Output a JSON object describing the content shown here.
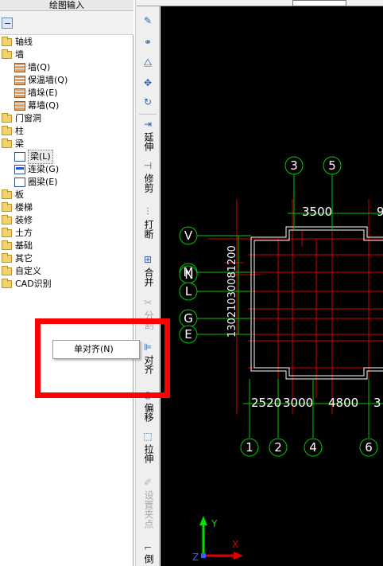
{
  "panel": {
    "title": "绘图输入",
    "tree": [
      {
        "label": "轴线",
        "type": "folder"
      },
      {
        "label": "墙",
        "type": "folder"
      },
      {
        "label": "墙(Q)",
        "type": "child"
      },
      {
        "label": "保温墙(Q)",
        "type": "child"
      },
      {
        "label": "墙垛(E)",
        "type": "child"
      },
      {
        "label": "幕墙(Q)",
        "type": "child"
      },
      {
        "label": "门窗洞",
        "type": "folder"
      },
      {
        "label": "柱",
        "type": "folder"
      },
      {
        "label": "梁",
        "type": "folder"
      },
      {
        "label": "梁(L)",
        "type": "child",
        "selected": true
      },
      {
        "label": "连梁(G)",
        "type": "child"
      },
      {
        "label": "圈梁(E)",
        "type": "child"
      },
      {
        "label": "板",
        "type": "folder"
      },
      {
        "label": "楼梯",
        "type": "folder"
      },
      {
        "label": "装修",
        "type": "folder"
      },
      {
        "label": "土方",
        "type": "folder"
      },
      {
        "label": "基础",
        "type": "folder"
      },
      {
        "label": "其它",
        "type": "folder"
      },
      {
        "label": "自定义",
        "type": "folder"
      },
      {
        "label": "CAD识别",
        "type": "folder"
      }
    ]
  },
  "toolbar": {
    "extend": "延伸",
    "trim": "修剪",
    "break": "打断",
    "merge": "合并",
    "split": "分割",
    "align": "对齐",
    "offset": "偏移",
    "stretch": "拉伸",
    "set_grip": "设置夹点",
    "chamfer": "倒"
  },
  "context_menu": {
    "item": "单对齐(N)"
  },
  "canvas": {
    "top_axes": [
      "3",
      "5"
    ],
    "top_dims": [
      "3500",
      "9"
    ],
    "left_axes": [
      "V",
      "M",
      "N",
      "L",
      "G",
      "E"
    ],
    "left_dims_vertical": "13021030081200",
    "bottom_dims": [
      "2520",
      "3000",
      "4800",
      "3"
    ],
    "bottom_axes": [
      "1",
      "2",
      "4",
      "6"
    ],
    "ucs_labels": [
      "Y",
      "X",
      "Z"
    ]
  },
  "colors": {
    "canvas_bg": "#000000",
    "axis_green": "#00c800",
    "grid_red": "#d00000",
    "highlight": "#ff0000"
  }
}
